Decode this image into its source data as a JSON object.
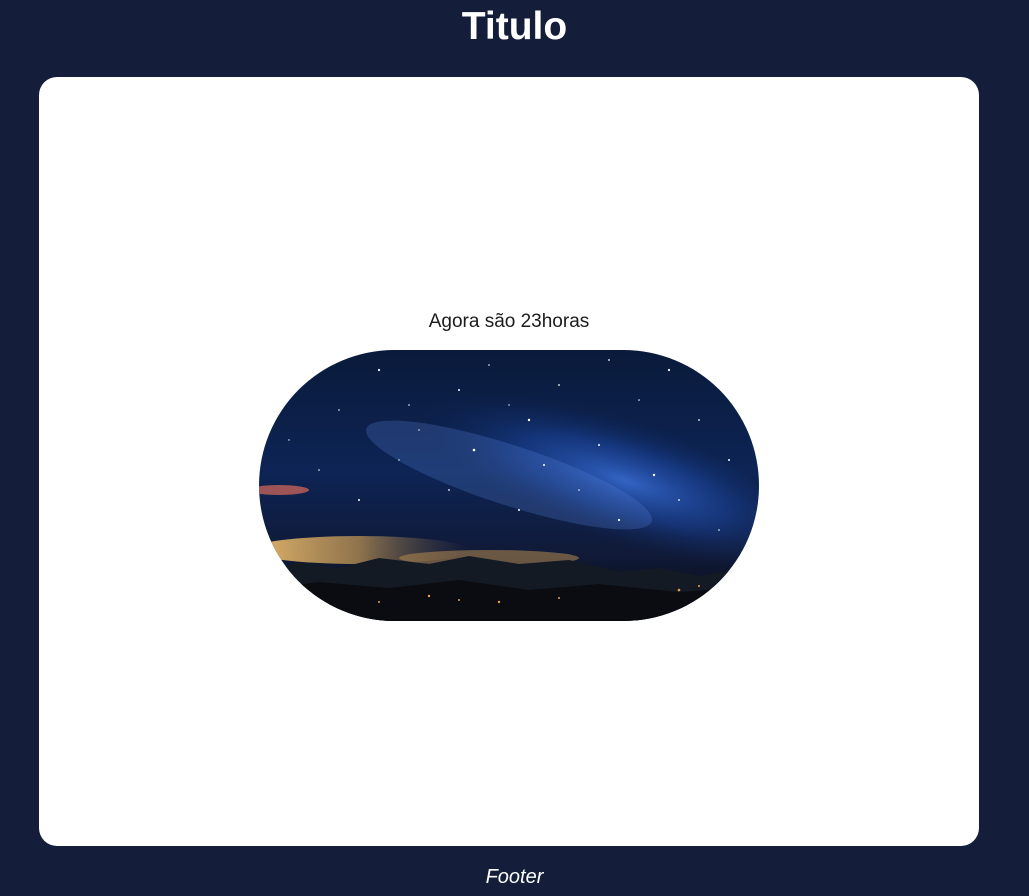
{
  "header": {
    "title": "Titulo"
  },
  "main": {
    "time_text": "Agora são 23horas",
    "image": {
      "subject": "night-sky-milky-way-image"
    }
  },
  "footer": {
    "text": "Footer"
  },
  "colors": {
    "page_background": "#141d39",
    "card_background": "#ffffff",
    "title_color": "#ffffff",
    "body_text_color": "#1c1c1c"
  }
}
